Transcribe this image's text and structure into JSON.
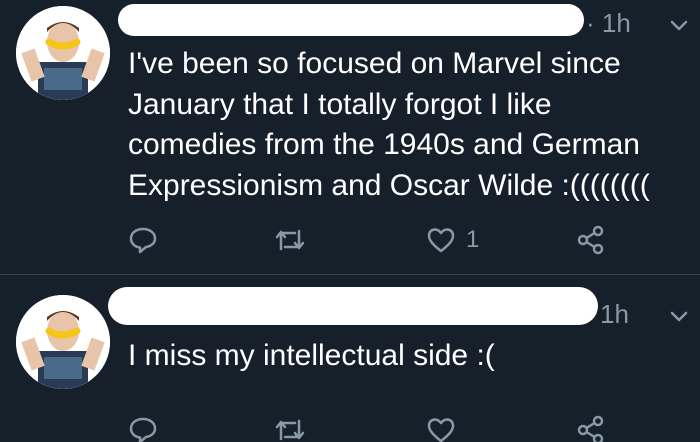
{
  "colors": {
    "background": "#15202b",
    "text": "#ffffff",
    "secondary_text": "#8899a6",
    "divider": "#38444d",
    "redaction": "#ffffff"
  },
  "tweets": [
    {
      "time": "· 1h",
      "text": "I've been so focused on Marvel since January that I totally forgot I like comedies from the 1940s and German Expressionism and Oscar Wilde :((((((((",
      "like_count": "1",
      "avatar_icon": "avatar-banana-shirt",
      "menu_icon": "chevron-down-icon"
    },
    {
      "time": "1h",
      "text": "I miss my intellectual side :(",
      "like_count": "",
      "avatar_icon": "avatar-banana-shirt",
      "menu_icon": "chevron-down-icon"
    }
  ],
  "action_icons": [
    "reply-icon",
    "retweet-icon",
    "like-icon",
    "share-icon"
  ]
}
